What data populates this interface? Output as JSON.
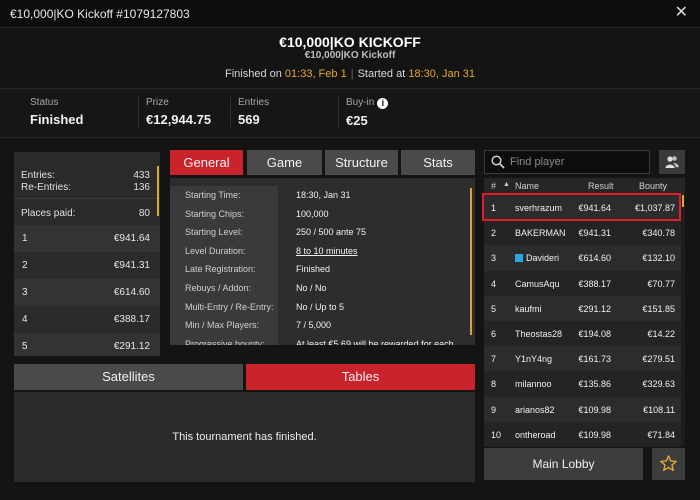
{
  "window": {
    "title": "€10,000|KO Kickoff #1079127803"
  },
  "header": {
    "title": "€10,000|KO KICKOFF",
    "subtitle": "€10,000|KO Kickoff",
    "finished_label": "Finished on",
    "finished_value": "01:33, Feb 1",
    "started_label": "Started at",
    "started_value": "18:30, Jan 31"
  },
  "stats": [
    {
      "label": "Status",
      "value": "Finished"
    },
    {
      "label": "Prize",
      "value": "€12,944.75"
    },
    {
      "label": "Entries",
      "value": "569"
    },
    {
      "label": "Buy-in",
      "value": "€25",
      "info_icon": "i"
    }
  ],
  "left_panel": {
    "entries_label": "Entries:",
    "entries_value": "433",
    "reentries_label": "Re-Entries:",
    "reentries_value": "136",
    "places_label": "Places paid:",
    "places_value": "80",
    "payouts": [
      {
        "place": "1",
        "amount": "€941.64"
      },
      {
        "place": "2",
        "amount": "€941.31"
      },
      {
        "place": "3",
        "amount": "€614.60"
      },
      {
        "place": "4",
        "amount": "€388.17"
      },
      {
        "place": "5",
        "amount": "€291.12"
      }
    ]
  },
  "tabs": [
    "General",
    "Game",
    "Structure",
    "Stats"
  ],
  "general": [
    {
      "label": "Starting Time:",
      "value": "18:30, Jan 31"
    },
    {
      "label": "Starting Chips:",
      "value": "100,000"
    },
    {
      "label": "Starting Level:",
      "value": "250 / 500 ante 75"
    },
    {
      "label": "Level Duration:",
      "value": "8 to 10 minutes",
      "link": true
    },
    {
      "label": "Late Registration:",
      "value": "Finished"
    },
    {
      "label": "Rebuys / Addon:",
      "value": "No / No"
    },
    {
      "label": "Multi-Entry / Re-Entry:",
      "value": "No / Up to 5"
    },
    {
      "label": "Min / Max Players:",
      "value": "7 / 5,000"
    },
    {
      "label": "Progressive bounty:",
      "value": "At least €5.69 will be rewarded for each"
    }
  ],
  "bottom_tabs": [
    "Satellites",
    "Tables"
  ],
  "finished_message": "This tournament has finished.",
  "search": {
    "placeholder": "Find player"
  },
  "players_header": {
    "rank": "#",
    "sort_arrow": "▲",
    "name": "Name",
    "result": "Result",
    "bounty": "Bounty"
  },
  "players": [
    {
      "rank": "1",
      "name": "sverhrazum",
      "result": "€941.64",
      "bounty": "€1,037.87"
    },
    {
      "rank": "2",
      "name": "BAKERMAN",
      "result": "€941.31",
      "bounty": "€340.78"
    },
    {
      "rank": "3",
      "name": "Davideri",
      "result": "€614.60",
      "bounty": "€132.10",
      "flag": true
    },
    {
      "rank": "4",
      "name": "CamusAqu",
      "result": "€388.17",
      "bounty": "€70.77"
    },
    {
      "rank": "5",
      "name": "kaufmi",
      "result": "€291.12",
      "bounty": "€151.85"
    },
    {
      "rank": "6",
      "name": "Theostas28",
      "result": "€194.08",
      "bounty": "€14.22"
    },
    {
      "rank": "7",
      "name": "Y1nY4ng",
      "result": "€161.73",
      "bounty": "€279.51"
    },
    {
      "rank": "8",
      "name": "milannoo",
      "result": "€135.86",
      "bounty": "€329.63"
    },
    {
      "rank": "9",
      "name": "arianos82",
      "result": "€109.98",
      "bounty": "€108.11"
    },
    {
      "rank": "10",
      "name": "ontheroad",
      "result": "€109.98",
      "bounty": "€71.84"
    }
  ],
  "buttons": {
    "main_lobby": "Main Lobby"
  },
  "colors": {
    "accent_red": "#c9232b",
    "highlight_red": "#e11d2a",
    "orange": "#e2a838"
  }
}
